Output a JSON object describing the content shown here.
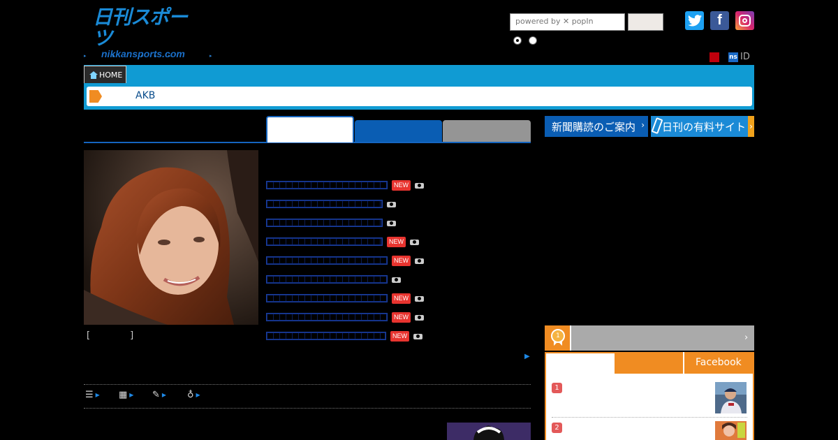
{
  "header": {
    "logo_main": "日刊スポーツ",
    "logo_sub": "nikkansports.com",
    "search_placeholder": "powered by ✕ popIn",
    "id_label": "ID",
    "ns_label": "ns"
  },
  "breadcrumb": {
    "home_label": "HOME",
    "current": "AKB"
  },
  "photo": {
    "caption": "[　　　　]"
  },
  "headlines": [
    {
      "new": true,
      "camera": true
    },
    {
      "new": false,
      "camera": true
    },
    {
      "new": false,
      "camera": true
    },
    {
      "new": true,
      "camera": true
    },
    {
      "new": true,
      "camera": true
    },
    {
      "new": false,
      "camera": true
    },
    {
      "new": true,
      "camera": true
    },
    {
      "new": true,
      "camera": true
    },
    {
      "new": true,
      "camera": true
    }
  ],
  "badges": {
    "new_label": "NEW"
  },
  "sidebar": {
    "banner1": "新聞購読のご案内",
    "banner2": "日刊の有料サイト",
    "ranking_tab_facebook": "Facebook",
    "ranking_items": [
      {
        "rank": "1"
      },
      {
        "rank": "2"
      }
    ]
  },
  "colors": {
    "accent_blue": "#109bd3",
    "tab_blue": "#0a5db3",
    "orange": "#f08c22",
    "new_red": "#e8342f"
  }
}
